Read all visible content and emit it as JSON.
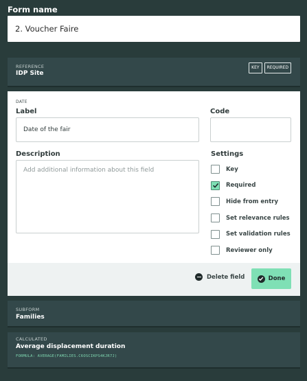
{
  "form": {
    "label": "Form name",
    "value": "2. Voucher Faire"
  },
  "reference_card": {
    "kind": "REFERENCE",
    "title": "IDP Site",
    "badges": [
      "KEY",
      "REQUIRED"
    ]
  },
  "editor": {
    "kind": "DATE",
    "label_heading": "Label",
    "label_value": "Date of the fair",
    "code_heading": "Code",
    "code_value": "",
    "description_heading": "Description",
    "description_placeholder": "Add additional information about this field",
    "settings_heading": "Settings",
    "settings": [
      {
        "label": "Key",
        "checked": false
      },
      {
        "label": "Required",
        "checked": true
      },
      {
        "label": "Hide from entry",
        "checked": false
      },
      {
        "label": "Set relevance rules",
        "checked": false
      },
      {
        "label": "Set validation rules",
        "checked": false
      },
      {
        "label": "Reviewer only",
        "checked": false
      }
    ],
    "delete_label": "Delete field",
    "done_label": "Done"
  },
  "subform_card": {
    "kind": "SUBFORM",
    "title": "Families"
  },
  "calculated_card": {
    "kind": "CALCULATED",
    "title": "Average displacement duration",
    "formula": "FORMULA: AVERAGE(FAMILIES.C6OSCIKPS4KJR7J)"
  },
  "colors": {
    "background": "#293c3b",
    "card": "#33484a",
    "accent": "#7fe0b5",
    "formula_text": "#7fd8b1"
  }
}
